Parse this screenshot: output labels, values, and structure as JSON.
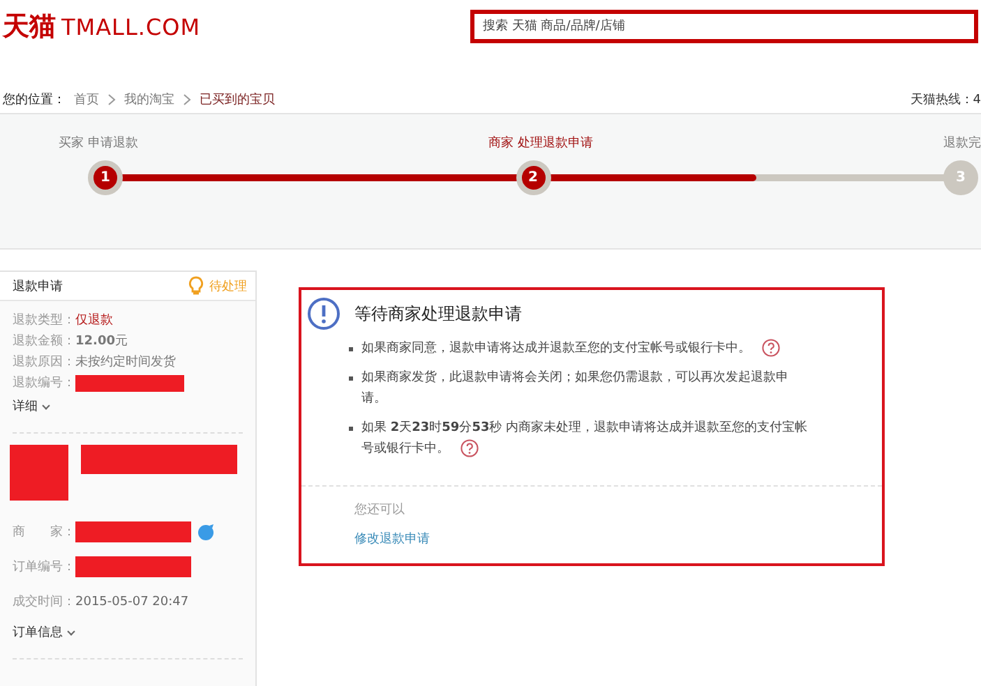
{
  "header": {
    "logo_cn": "天猫",
    "logo_en": "TMALL.COM",
    "search": {
      "placeholder": "搜索 天猫 商品/品牌/店铺"
    }
  },
  "breadcrumb": {
    "label": "您的位置：",
    "items": [
      {
        "text": "首页",
        "selected": false
      },
      {
        "text": "我的淘宝",
        "selected": false
      },
      {
        "text": "已买到的宝贝",
        "selected": true
      }
    ],
    "hotline": "天猫热线：4"
  },
  "steps": {
    "level": 0.76,
    "items": [
      {
        "number": "1",
        "label": "买家 申请退款",
        "done": true,
        "selected": false
      },
      {
        "number": "2",
        "label": "商家 处理退款申请",
        "done": true,
        "selected": true
      },
      {
        "number": "3",
        "label": "退款完",
        "done": false,
        "selected": false
      }
    ]
  },
  "sidebar": {
    "title": "退款申请",
    "status": "待处理",
    "fields": [
      {
        "label": "退款类型：",
        "kind": "text",
        "value": "仅退款",
        "accent": true
      },
      {
        "label": "退款金额：",
        "kind": "text",
        "value": "**12.00**元",
        "accent": false
      },
      {
        "label": "退款原因：",
        "kind": "text",
        "value": "未按约定时间发货",
        "accent": false
      },
      {
        "label": "退款编号：",
        "kind": "redacted"
      }
    ],
    "details_link": "详细",
    "order_fields": [
      {
        "label": "商　　家：",
        "kind": "redacted",
        "chat": true
      },
      {
        "label": "订单编号：",
        "kind": "redacted",
        "chat": false
      },
      {
        "label": "成交时间：",
        "kind": "text",
        "value": "2015-05-07 20:47",
        "chat": false
      }
    ],
    "order_link": "订单信息"
  },
  "notice": {
    "title": "等待商家处理退款申请",
    "bullets": [
      {
        "text": "如果商家同意，退款申请将达成并退款至您的支付宝帐号或银行卡中。",
        "help": true
      },
      {
        "text": "如果商家发货，此退款申请将会关闭；如果您仍需退款，可以再次发起退款申请。",
        "help": false
      },
      {
        "text": "如果 **2**天**23**时**59**分**53**秒 内商家未处理，退款申请将达成并退款至您的支付宝帐号或银行卡中。",
        "help": true
      }
    ],
    "options_label": "您还可以",
    "action": "修改退款申请"
  }
}
